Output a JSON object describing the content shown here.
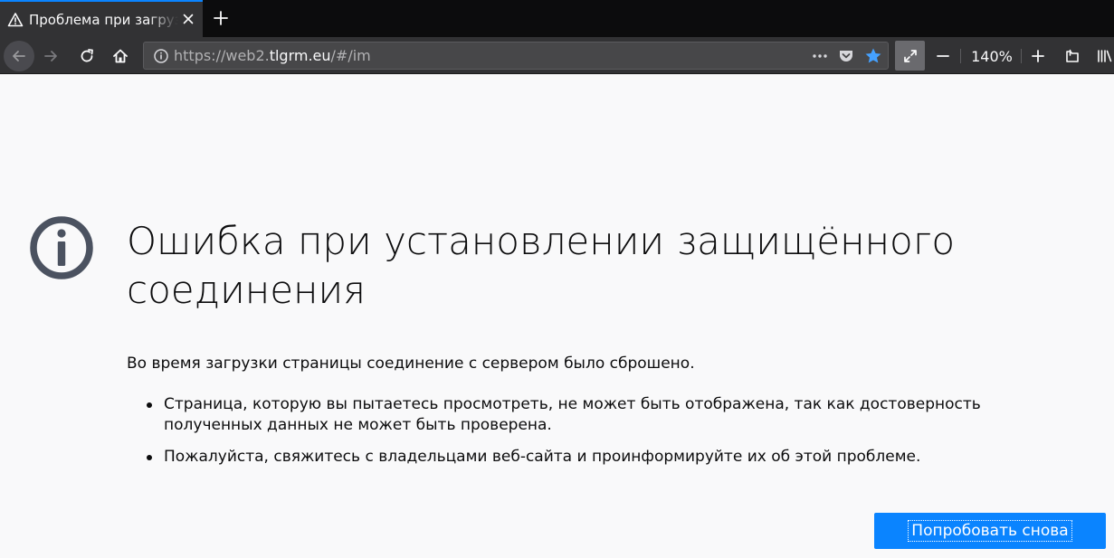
{
  "browser": {
    "tab": {
      "title": "Проблема при загрузке страницы",
      "icon": "warning-icon"
    },
    "url": {
      "prefix": "https://web2.",
      "host": "tlgrm.eu",
      "path": "/#/im"
    },
    "zoom_level": "140%",
    "colors": {
      "accent": "#0a84ff",
      "toolbar": "#323234",
      "tabstrip": "#0c0c0d"
    }
  },
  "error": {
    "title": "Ошибка при установлении защищённого соединения",
    "description": "Во время загрузки страницы соединение с сервером было сброшено.",
    "bullets": [
      "Страница, которую вы пытаетесь просмотреть, не может быть отображена, так как достоверность полученных данных не может быть проверена.",
      "Пожалуйста, свяжитесь с владельцами веб-сайта и проинформируйте их об этой проблеме."
    ],
    "retry_label": "Попробовать снова",
    "icon": "info-circle-icon"
  }
}
